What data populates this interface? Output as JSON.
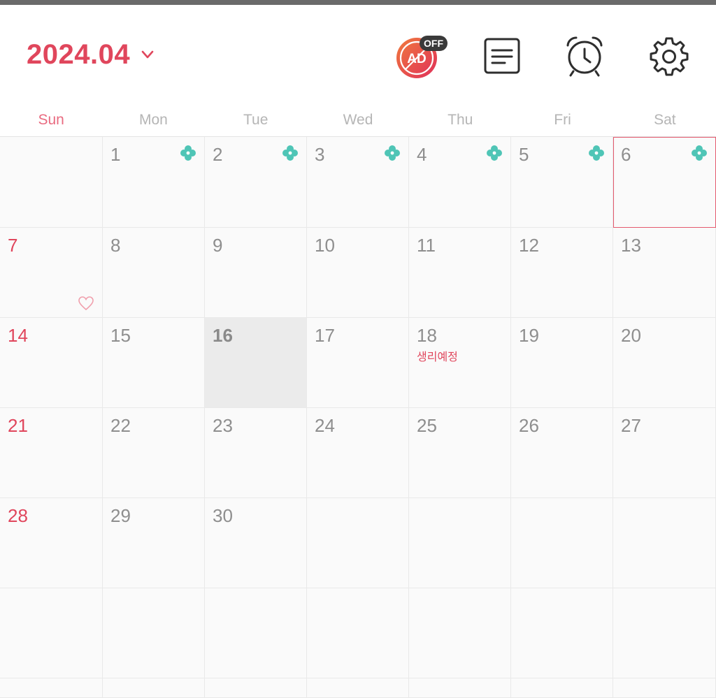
{
  "header": {
    "month_title": "2024.04",
    "ad_badge": "AD",
    "ad_off_label": "OFF",
    "icons": [
      "chevron-down-icon",
      "ad-off-icon",
      "memo-icon",
      "alarm-clock-icon",
      "gear-icon"
    ]
  },
  "colors": {
    "accent": "#e0465c",
    "flower": "#4fc5b6",
    "today_bg": "#ebebeb"
  },
  "weekdays": [
    "Sun",
    "Mon",
    "Tue",
    "Wed",
    "Thu",
    "Fri",
    "Sat"
  ],
  "calendar": {
    "today": "16",
    "selected": "6",
    "rows": [
      [
        "",
        "1",
        "2",
        "3",
        "4",
        "5",
        "6"
      ],
      [
        "7",
        "8",
        "9",
        "10",
        "11",
        "12",
        "13"
      ],
      [
        "14",
        "15",
        "16",
        "17",
        "18",
        "19",
        "20"
      ],
      [
        "21",
        "22",
        "23",
        "24",
        "25",
        "26",
        "27"
      ],
      [
        "28",
        "29",
        "30",
        "",
        "",
        "",
        ""
      ],
      [
        "",
        "",
        "",
        "",
        "",
        "",
        ""
      ],
      [
        "",
        "",
        "",
        "",
        "",
        "",
        ""
      ]
    ],
    "flower_markers": [
      "1",
      "2",
      "3",
      "4",
      "5",
      "6"
    ],
    "heart_markers": [
      "7"
    ],
    "events": [
      {
        "day": "18",
        "label": "생리예정"
      }
    ]
  }
}
